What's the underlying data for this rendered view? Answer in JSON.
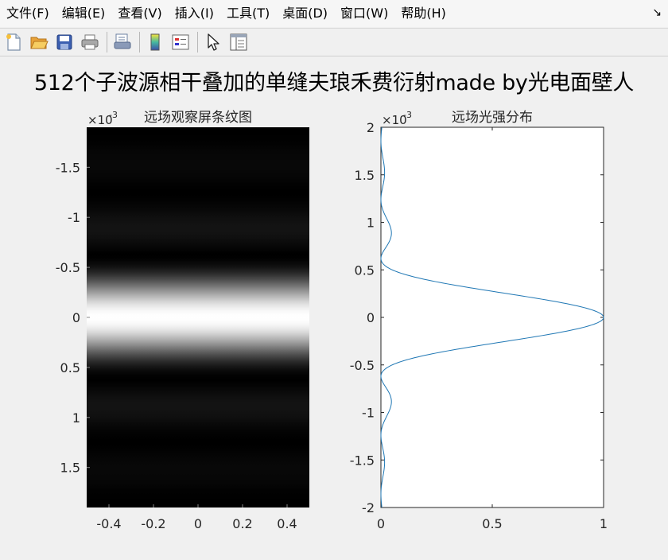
{
  "menu": {
    "items": [
      "文件(F)",
      "编辑(E)",
      "查看(V)",
      "插入(I)",
      "工具(T)",
      "桌面(D)",
      "窗口(W)",
      "帮助(H)"
    ],
    "corner_glyph": "↘"
  },
  "toolbar": {
    "icons": [
      "new-file-icon",
      "open-folder-icon",
      "save-icon",
      "print-icon",
      "print-preview-icon",
      "colorbar-icon",
      "legend-icon",
      "pointer-icon",
      "property-inspector-icon"
    ]
  },
  "figure": {
    "title": "512个子波源相干叠加的单缝夫琅禾费衍射made by光电面壁人"
  },
  "chart_data": [
    {
      "type": "heatmap",
      "title": "远场观察屏条纹图",
      "colormap": "gray",
      "xlim": [
        -0.5,
        0.5
      ],
      "ylim": [
        -0.0019,
        0.0019
      ],
      "y_reversed": true,
      "xticks": [
        "-0.4",
        "-0.2",
        "0",
        "0.2",
        "0.4"
      ],
      "yticks": [
        "-1.5",
        "-1",
        "-0.5",
        "0",
        "0.5",
        "1",
        "1.5"
      ],
      "y_exponent_base": "×10",
      "y_exponent": "-3",
      "intensity_profile": "sinc^2, central maximum at 0, first zeros at ±0.62e-3"
    },
    {
      "type": "line",
      "title": "远场光强分布",
      "xlim": [
        0,
        1
      ],
      "ylim": [
        -0.002,
        0.002
      ],
      "xticks": [
        "0",
        "0.5",
        "1"
      ],
      "yticks": [
        "2",
        "1.5",
        "1",
        "0.5",
        "0",
        "-0.5",
        "-1",
        "-1.5",
        "-2"
      ],
      "y_exponent_base": "×10",
      "y_exponent": "-3",
      "line_color": "#1f77b4",
      "first_zero": 0.00062,
      "series": [
        {
          "x_formula": "sinc^2",
          "peak": 1
        }
      ]
    }
  ]
}
